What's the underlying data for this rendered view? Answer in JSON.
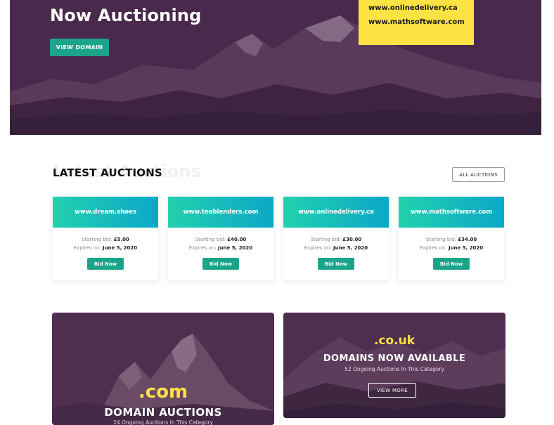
{
  "hero": {
    "title": "Now Auctioning",
    "view_domain_label": "VIEW DOMAIN",
    "featured_domains": [
      "www.onlinedelivery.ca",
      "www.mathsoftware.com"
    ]
  },
  "latest": {
    "title": "LATEST AUCTIONS",
    "ghost_title": "Latest Auctions",
    "all_label": "ALL AUCTIONS",
    "starting_prefix": "Starting bid:",
    "expires_prefix": "Expires on:",
    "bid_label": "Bid Now",
    "cards": [
      {
        "domain": "www.dream.shoes",
        "bid": "£5.00",
        "expires": "June 5, 2020"
      },
      {
        "domain": "www.teablenders.com",
        "bid": "£40.00",
        "expires": "June 5, 2020"
      },
      {
        "domain": "www.onlinedelivery.ca",
        "bid": "£30.00",
        "expires": "June 5, 2020"
      },
      {
        "domain": "www.mathsoftware.com",
        "bid": "£34.00",
        "expires": "June 5, 2020"
      }
    ]
  },
  "promos": {
    "com": {
      "ext": ".com",
      "title": "DOMAIN AUCTIONS",
      "subtitle": "24 Ongoing Auctions In This Category"
    },
    "couk": {
      "ext": ".co.uk",
      "title": "DOMAINS NOW AVAILABLE",
      "subtitle": "52 Ongoing Auctions In This Category",
      "button": "VIEW MORE"
    }
  },
  "colors": {
    "hero_bg": "#4a2a4c",
    "accent_green": "#1aa58a",
    "highlight_yellow": "#fde244",
    "card_gradient_start": "#24d0ae",
    "card_gradient_end": "#0aa8c8"
  }
}
